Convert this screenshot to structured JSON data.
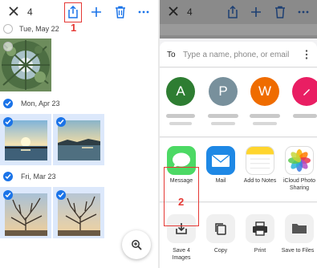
{
  "annotations": {
    "step1": "1",
    "step2": "2"
  },
  "left": {
    "toolbar": {
      "count": "4",
      "icons": [
        "close-icon",
        "share-icon",
        "add-icon",
        "delete-icon",
        "more-icon"
      ]
    },
    "groups": [
      {
        "date": "Tue, May 22",
        "selected": false
      },
      {
        "date": "Mon, Apr 23",
        "selected": true
      },
      {
        "date": "Fri, Mar 23",
        "selected": true
      }
    ],
    "zoom_icon": "zoom-icon"
  },
  "right": {
    "toolbar": {
      "count": "4"
    },
    "share": {
      "to_label": "To",
      "to_placeholder": "Type a name, phone, or email",
      "contacts": [
        {
          "initial": "A",
          "color": "#2e7d32"
        },
        {
          "initial": "P",
          "color": "#78909c"
        },
        {
          "initial": "W",
          "color": "#ef6c00"
        },
        {
          "initial": "",
          "color": "#e91e63"
        }
      ],
      "apps": [
        {
          "name": "Message",
          "icon": "message-icon"
        },
        {
          "name": "Mail",
          "icon": "mail-icon"
        },
        {
          "name": "Add to Notes",
          "icon": "notes-icon"
        },
        {
          "name": "iCloud Photo Sharing",
          "line1": "iCloud Photo",
          "line2": "Sharing",
          "icon": "photos-icon"
        }
      ],
      "actions": [
        {
          "name": "Save 4 Images",
          "line1": "Save 4",
          "line2": "Images",
          "icon": "save-icon"
        },
        {
          "name": "Copy",
          "icon": "copy-icon"
        },
        {
          "name": "Print",
          "icon": "print-icon"
        },
        {
          "name": "Save to Files",
          "icon": "folder-icon"
        }
      ]
    }
  },
  "colors": {
    "accent": "#1a73e8",
    "annotation": "#e53935"
  }
}
